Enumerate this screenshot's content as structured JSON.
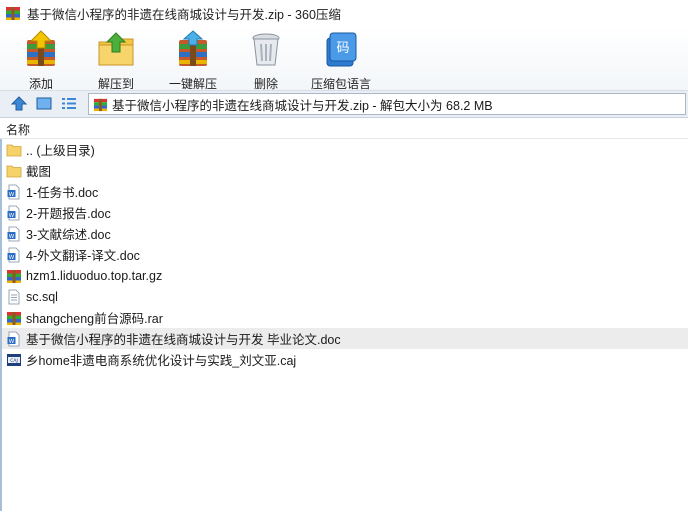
{
  "window": {
    "title": "基于微信小程序的非遗在线商城设计与开发.zip - 360压缩"
  },
  "toolbar": {
    "add": "添加",
    "extract_to": "解压到",
    "one_click_extract": "一键解压",
    "delete": "删除",
    "language": "压缩包语言",
    "language_icon_char": "码"
  },
  "address": {
    "text": "基于微信小程序的非遗在线商城设计与开发.zip - 解包大小为 68.2 MB"
  },
  "list": {
    "column_name": "名称",
    "items": [
      {
        "name": ".. (上级目录)",
        "icon": "folder-icon"
      },
      {
        "name": "截图",
        "icon": "folder-icon"
      },
      {
        "name": "1-任务书.doc",
        "icon": "word-doc-icon"
      },
      {
        "name": "2-开题报告.doc",
        "icon": "word-doc-icon"
      },
      {
        "name": "3-文献综述.doc",
        "icon": "word-doc-icon"
      },
      {
        "name": "4-外文翻译-译文.doc",
        "icon": "word-doc-icon"
      },
      {
        "name": "hzm1.liduoduo.top.tar.gz",
        "icon": "archive-icon"
      },
      {
        "name": "sc.sql",
        "icon": "text-file-icon"
      },
      {
        "name": "shangcheng前台源码.rar",
        "icon": "archive-icon"
      },
      {
        "name": "基于微信小程序的非遗在线商城设计与开发 毕业论文.doc",
        "icon": "word-doc-icon"
      },
      {
        "name": "乡home非遗电商系统优化设计与实践_刘文亚.caj",
        "icon": "caj-file-icon"
      }
    ],
    "selected_index": 9
  }
}
